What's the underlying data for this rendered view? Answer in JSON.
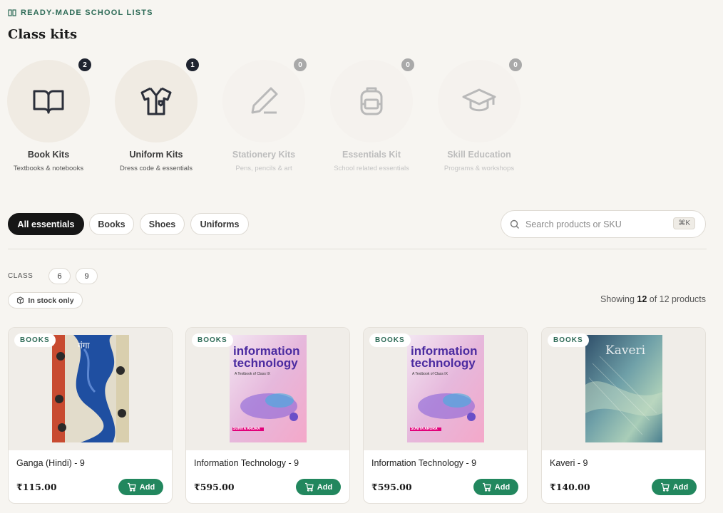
{
  "header": {
    "eyebrow": "READY-MADE SCHOOL LISTS",
    "title": "Class kits"
  },
  "kits": [
    {
      "title": "Book Kits",
      "subtitle": "Textbooks & notebooks",
      "count": "2",
      "icon": "open-book-icon",
      "enabled": true
    },
    {
      "title": "Uniform Kits",
      "subtitle": "Dress code & essentials",
      "count": "1",
      "icon": "shirt-icon",
      "enabled": true
    },
    {
      "title": "Stationery Kits",
      "subtitle": "Pens, pencils & art",
      "count": "0",
      "icon": "pencil-icon",
      "enabled": false
    },
    {
      "title": "Essentials Kit",
      "subtitle": "School related essentials",
      "count": "0",
      "icon": "backpack-icon",
      "enabled": false
    },
    {
      "title": "Skill Education",
      "subtitle": "Programs & workshops",
      "count": "0",
      "icon": "graduation-cap-icon",
      "enabled": false
    }
  ],
  "filters": {
    "tabs": [
      "All essentials",
      "Books",
      "Shoes",
      "Uniforms"
    ],
    "active": "All essentials",
    "search_placeholder": "Search products or SKU",
    "shortcut": "⌘K",
    "class_label": "CLASS",
    "classes": [
      "6",
      "9"
    ],
    "stock_label": "In stock only"
  },
  "results": {
    "prefix": "Showing",
    "shown": "12",
    "middle": "of 12 products"
  },
  "products": [
    {
      "tag": "BOOKS",
      "name": "Ganga (Hindi) - 9",
      "price": "₹115.00",
      "add_label": "Add",
      "cover_title": "गंगा"
    },
    {
      "tag": "BOOKS",
      "name": "Information Technology - 9",
      "price": "₹595.00",
      "add_label": "Add",
      "cover_title": "information technology",
      "cover_sub": "A Textbook of Class IX",
      "cover_author": "SUNITA ARORA"
    },
    {
      "tag": "BOOKS",
      "name": "Information Technology - 9",
      "price": "₹595.00",
      "add_label": "Add",
      "cover_title": "information technology",
      "cover_sub": "A Textbook of Class IX",
      "cover_author": "SUNITA ARORA"
    },
    {
      "tag": "BOOKS",
      "name": "Kaveri - 9",
      "price": "₹140.00",
      "add_label": "Add",
      "cover_title": "Kaveri"
    }
  ],
  "colors": {
    "accent_green": "#22875e",
    "eyebrow_green": "#2e6b57",
    "badge_dark": "#1f2430",
    "active_pill": "#161616",
    "background": "#f7f5f1"
  }
}
